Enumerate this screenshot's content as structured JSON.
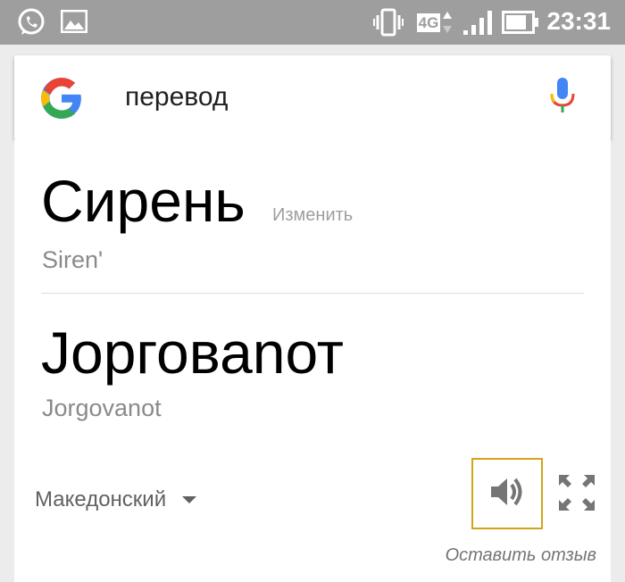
{
  "status_bar": {
    "time": "23:31",
    "network_label": "4G",
    "icons": [
      "whatsapp-icon",
      "gallery-icon",
      "vibrate-icon",
      "network-4g-icon",
      "signal-icon",
      "battery-icon"
    ]
  },
  "search": {
    "query": "перевод",
    "logo": "google-g-logo",
    "mic_icon": "mic-icon"
  },
  "translation": {
    "source_word": "Сирень",
    "change_label": "Изменить",
    "source_transliteration": "Siren'",
    "target_word": "Јорговаnот",
    "target_transliteration": "Jorgovanot",
    "target_language": "Македонский",
    "speak_icon": "speaker-icon",
    "expand_icon": "fullscreen-icon",
    "feedback_label": "Оставить отзыв"
  },
  "colors": {
    "status_bar": "#9e9e9e",
    "background": "#ececec",
    "accent_border": "#d3a419",
    "google_blue": "#4285f4",
    "google_red": "#ea4335",
    "google_yellow": "#fbbc05",
    "google_green": "#34a853"
  }
}
